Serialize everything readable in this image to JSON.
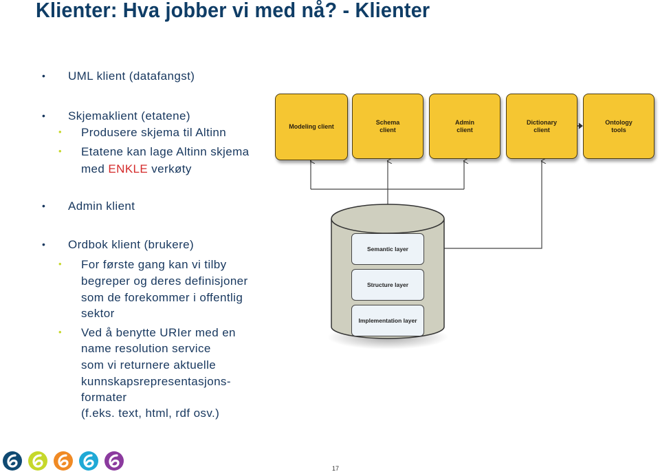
{
  "title": "Klienter: Hva jobber vi med nå? - Klienter",
  "bullets": {
    "uml": "UML klient (datafangst)",
    "skjema": "Skjemaklient (etatene)",
    "skjema_sub1": "Produsere skjema til Altinn",
    "skjema_sub2_a": "Etatene kan lage Altinn skjema",
    "skjema_sub2_b_prefix": "med ",
    "skjema_sub2_b_red": "ENKLE",
    "skjema_sub2_b_suffix": " verkøty",
    "admin": "Admin klient",
    "ordbok": "Ordbok klient (brukere)",
    "ordbok_sub1_line1": "For første gang kan vi tilby",
    "ordbok_sub1_line2_red": "begreper og deres definisjoner",
    "ordbok_sub1_line3": "som de forekommer i offentlig",
    "ordbok_sub1_line4": "sektor",
    "ordbok_sub2_line1": "Ved å benytte URIer med en",
    "ordbok_sub2_line2_red": "name resolution service",
    "ordbok_sub2_line3": "som vi returnere aktuelle",
    "ordbok_sub2_line4": "kunnskapsrepresentasjons-",
    "ordbok_sub2_line5": "formater",
    "ordbok_sub2_line6": "(f.eks. text, html, rdf osv.)"
  },
  "diagram": {
    "clients": [
      {
        "label": "Modeling client"
      },
      {
        "label": "Schema client"
      },
      {
        "label": "Admin client"
      },
      {
        "label": "Dictionary client"
      },
      {
        "label": "Ontology tools"
      }
    ],
    "layers": [
      {
        "label": "Semantic layer"
      },
      {
        "label": "Structure layer"
      },
      {
        "label": "Implementation layer"
      }
    ],
    "colors": {
      "client_fill": "#f5c632",
      "cylinder_fill": "#cfcfbf",
      "layer_fill": "#edf3f8"
    }
  },
  "footer": {
    "logos": [
      {
        "name": "dark-blue",
        "color": "#0f4a72"
      },
      {
        "name": "lime",
        "color": "#c6d82b"
      },
      {
        "name": "orange",
        "color": "#f08a24"
      },
      {
        "name": "cyan",
        "color": "#1fa9d6"
      },
      {
        "name": "purple",
        "color": "#8b3a9e"
      }
    ],
    "page_number": "17"
  }
}
